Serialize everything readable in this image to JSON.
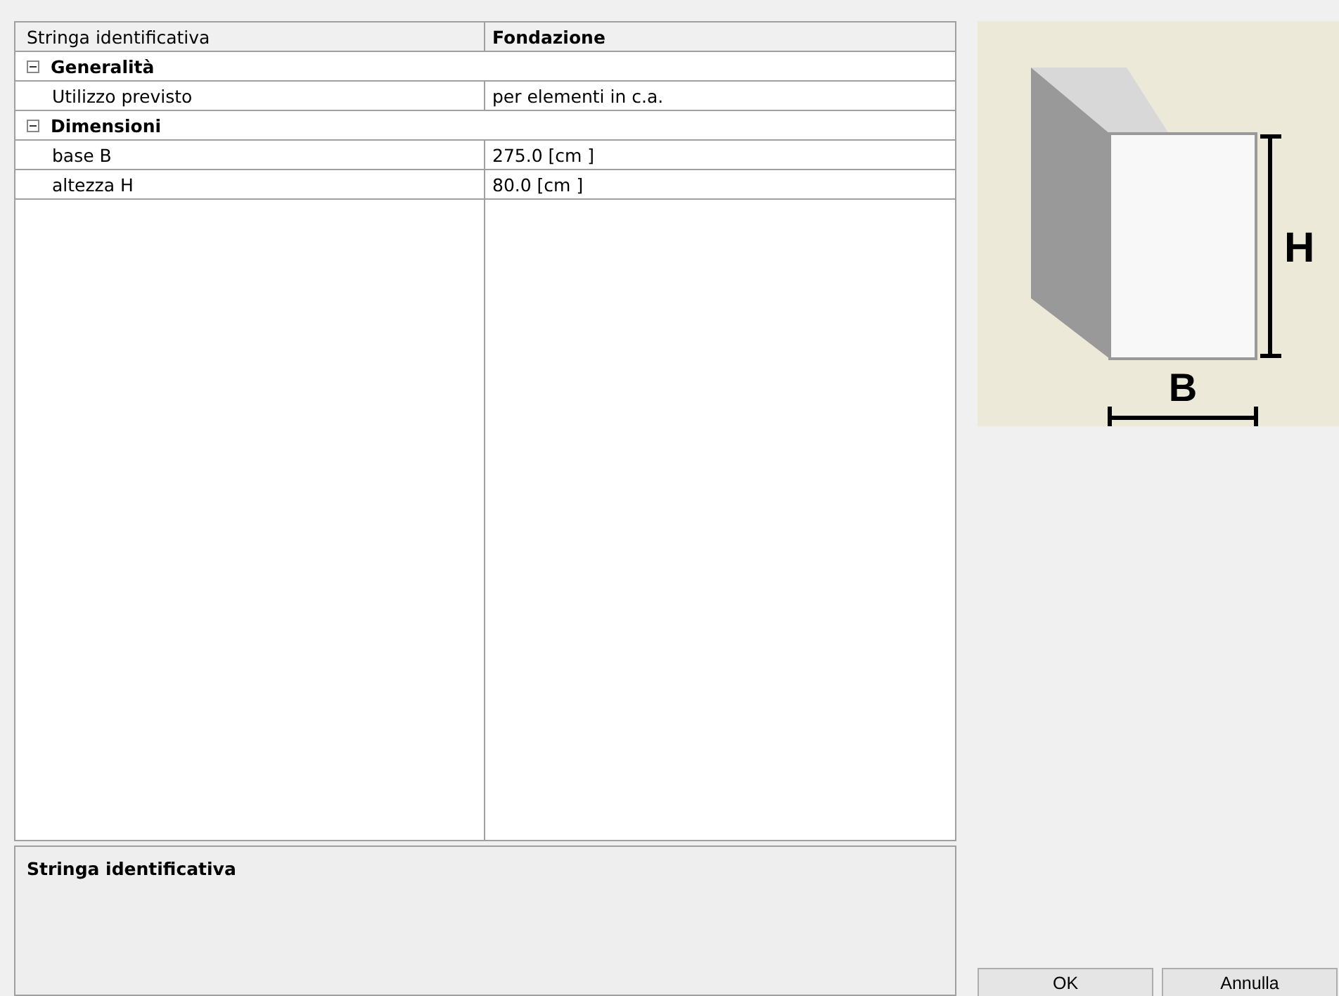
{
  "property_grid": {
    "header": {
      "label": "Stringa identificativa",
      "value": "Fondazione"
    },
    "rows": [
      {
        "kind": "category",
        "label": "Generalità",
        "expanded": true
      },
      {
        "kind": "property",
        "label": "Utilizzo previsto",
        "value": "per elementi in c.a."
      },
      {
        "kind": "category",
        "label": "Dimensioni",
        "expanded": true
      },
      {
        "kind": "property",
        "label": "base B",
        "value": "275.0  [cm ]"
      },
      {
        "kind": "property",
        "label": "altezza H",
        "value": "80.0  [cm ]"
      }
    ]
  },
  "description": {
    "title": "Stringa identificativa"
  },
  "preview": {
    "labels": [
      "H",
      "B"
    ]
  },
  "buttons": [
    "OK",
    "Annulla"
  ]
}
